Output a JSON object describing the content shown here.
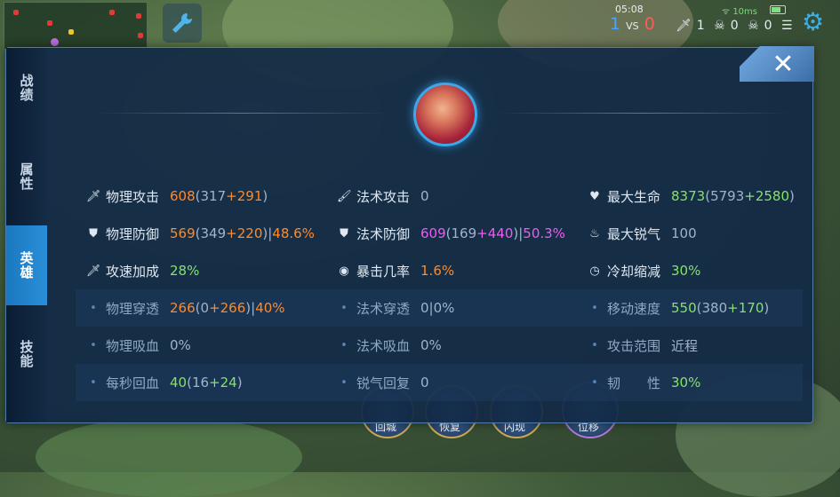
{
  "status": {
    "time": "05:08",
    "signal": "10ms",
    "score_blue": "1",
    "score_vs": "VS",
    "score_red": "0",
    "kills": "1",
    "deaths": "0",
    "assists": "0"
  },
  "tabs": [
    {
      "label": "战绩"
    },
    {
      "label": "属性"
    },
    {
      "label": "英雄",
      "active": true
    },
    {
      "label": "技能"
    }
  ],
  "close_label": "✕",
  "stats": {
    "physical_attack": {
      "label": "物理攻击",
      "total": "608",
      "base": "317",
      "bonus": "291"
    },
    "magic_attack": {
      "label": "法术攻击",
      "value": "0"
    },
    "max_hp": {
      "label": "最大生命",
      "total": "8373",
      "base": "5793",
      "bonus": "2580"
    },
    "physical_defense": {
      "label": "物理防御",
      "total": "569",
      "base": "349",
      "bonus": "220",
      "percent": "48.6%"
    },
    "magic_defense": {
      "label": "法术防御",
      "total": "609",
      "base": "169",
      "bonus": "440",
      "percent": "50.3%"
    },
    "max_energy": {
      "label": "最大锐气",
      "value": "100"
    },
    "attack_speed": {
      "label": "攻速加成",
      "value": "28%"
    },
    "crit_rate": {
      "label": "暴击几率",
      "value": "1.6%"
    },
    "cooldown": {
      "label": "冷却缩减",
      "value": "30%"
    },
    "physical_pen": {
      "label": "物理穿透",
      "total": "266",
      "base": "0",
      "bonus": "266",
      "percent": "40%"
    },
    "magic_pen": {
      "label": "法术穿透",
      "value": "0|0%"
    },
    "move_speed": {
      "label": "移动速度",
      "total": "550",
      "base": "380",
      "bonus": "170"
    },
    "physical_lifesteal": {
      "label": "物理吸血",
      "value": "0%"
    },
    "magic_lifesteal": {
      "label": "法术吸血",
      "value": "0%"
    },
    "attack_range": {
      "label": "攻击范围",
      "value": "近程"
    },
    "hp_regen": {
      "label": "每秒回血",
      "total": "40",
      "base": "16",
      "bonus": "24"
    },
    "energy_regen": {
      "label": "锐气回复",
      "value": "0"
    },
    "tenacity": {
      "label": "韧　　性",
      "value": "30%"
    }
  },
  "skill_bar": {
    "recall": "回城",
    "heal": "恢复",
    "flash": "闪现",
    "displace": "位移"
  },
  "colors": {
    "accent": "#2a8fd8",
    "orange": "#ff8a2a",
    "pink": "#ee5cf0",
    "green": "#86e26c"
  }
}
